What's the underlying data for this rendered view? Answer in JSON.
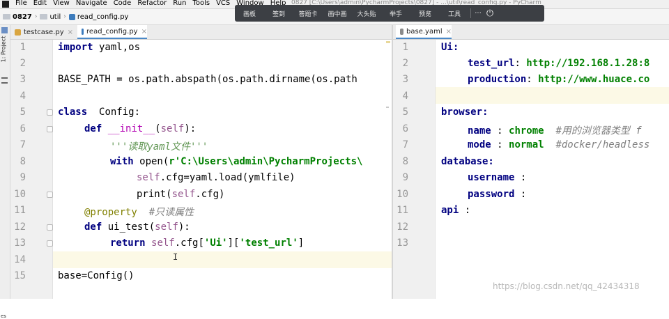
{
  "menubar": {
    "items": [
      "File",
      "Edit",
      "View",
      "Navigate",
      "Code",
      "Refactor",
      "Run",
      "Tools",
      "VCS",
      "Window",
      "Help"
    ],
    "window_title": "0827 [C:\\Users\\admin\\PycharmProjects\\0827] - ...\\util\\read_config.py - PyCharm"
  },
  "overlay_toolbar": {
    "tools": [
      "画板",
      "签到",
      "答题卡",
      "画中画",
      "大头贴",
      "举手",
      "预览",
      "工具"
    ],
    "more": "···",
    "power": "⏻"
  },
  "breadcrumb": {
    "items": [
      "0827",
      "util",
      "read_config.py"
    ]
  },
  "toolstrip": {
    "project_label": "1: Project",
    "bottom_label": "es"
  },
  "left_tabs": [
    {
      "label": "testcase.py",
      "active": false,
      "icon_color": "#d9a53f"
    },
    {
      "label": "read_config.py",
      "active": true,
      "icon_color": "#3d7cbd"
    }
  ],
  "right_tabs": [
    {
      "label": "base.yaml",
      "active": true,
      "icon_color": "#8a8a8a"
    }
  ],
  "left_editor": {
    "line_numbers": [
      "1",
      "2",
      "3",
      "4",
      "5",
      "6",
      "7",
      "8",
      "9",
      "10",
      "11",
      "12",
      "13",
      "14",
      "15"
    ],
    "current_line": 14
  },
  "right_editor": {
    "line_numbers": [
      "1",
      "2",
      "3",
      "4",
      "5",
      "6",
      "7",
      "8",
      "9",
      "10",
      "11",
      "12",
      "13"
    ],
    "current_line": 4
  },
  "code": {
    "l1": {
      "kw": "import",
      "rest": " yaml,os"
    },
    "l3": "BASE_PATH = os.path.abspath(os.path.dirname(os.path",
    "l5": {
      "kw": "class",
      "rest": "  Config:"
    },
    "l6": {
      "kw": "def",
      "sp": " ",
      "magic": "__init__",
      "p1": "(",
      "self": "self",
      "p2": "):"
    },
    "l7": "'''读取yaml文件'''",
    "l8": {
      "kw": "with",
      "rest": " open(",
      "str": "r'C:\\Users\\admin\\PycharmProjects\\"
    },
    "l9": {
      "self": "self",
      "rest": ".cfg=yaml.load(ymlfile)"
    },
    "l10": {
      "pre": "print(",
      "self": "self",
      "post": ".cfg)"
    },
    "l11": {
      "deco": "@property",
      "cmt": "  #只读属性"
    },
    "l12": {
      "kw": "def",
      "pre": " ui_test(",
      "self": "self",
      "post": "):"
    },
    "l13": {
      "kw": "return",
      "sp": " ",
      "self": "self",
      "a": ".cfg[",
      "s1": "'Ui'",
      "b": "][",
      "s2": "'test_url'",
      "c": "]"
    },
    "l15": "base=Config()"
  },
  "yaml": {
    "l1": "Ui:",
    "l2": {
      "key": "test_url",
      "sep": ": ",
      "val": "http://192.168.1.28:8"
    },
    "l3": {
      "key": "production",
      "sep": ": ",
      "val": "http://www.huace.co"
    },
    "l5": "browser:",
    "l6": {
      "key": "name",
      "sep": " : ",
      "val": "chrome",
      "cmt": "  #用的浏览器类型 f"
    },
    "l7": {
      "key": "mode",
      "sep": " : ",
      "val": "normal",
      "cmt": "  #docker/headless"
    },
    "l8": "database:",
    "l9": {
      "key": "username",
      "sep": " :"
    },
    "l10": {
      "key": "password",
      "sep": " :"
    },
    "l11": {
      "key": "api",
      "sep": " :"
    }
  },
  "watermark": "https://blog.csdn.net/qq_42434318"
}
